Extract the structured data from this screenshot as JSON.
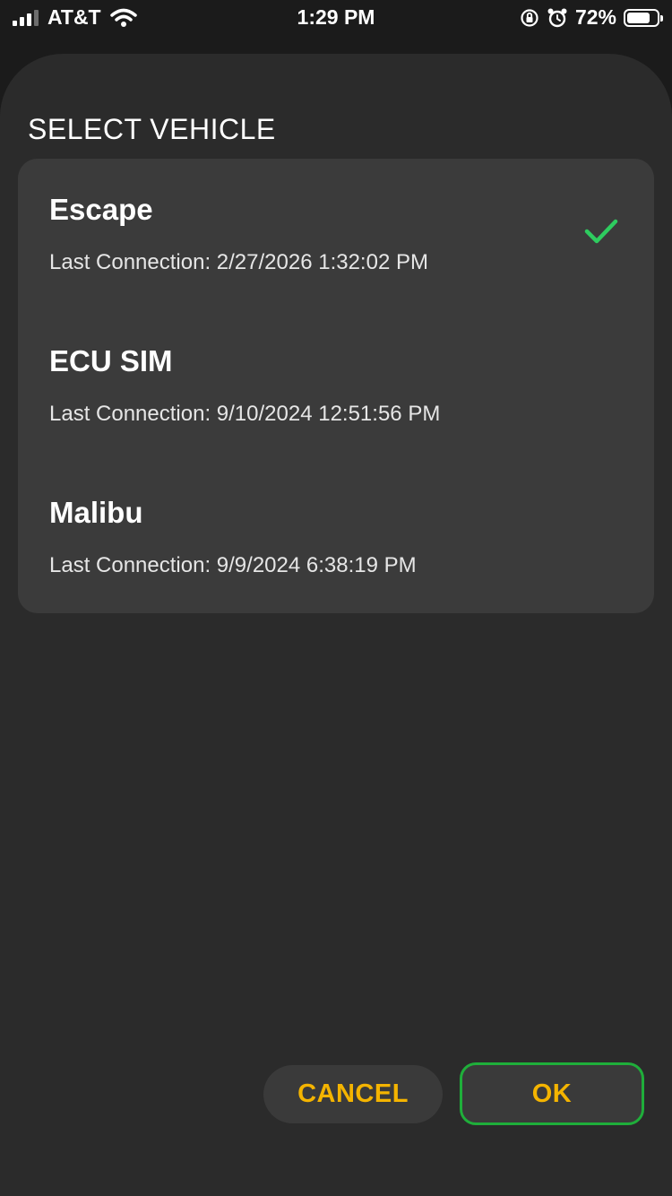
{
  "status_bar": {
    "carrier": "AT&T",
    "time": "1:29 PM",
    "battery_percent": "72%",
    "battery_level": 0.72,
    "icons": [
      "signal-icon",
      "wifi-icon",
      "rotation-lock-icon",
      "alarm-icon",
      "battery-icon"
    ]
  },
  "sheet": {
    "title": "SELECT VEHICLE"
  },
  "vehicles": [
    {
      "name": "Escape",
      "last_connection": "Last Connection: 2/27/2026 1:32:02 PM",
      "selected": true
    },
    {
      "name": "ECU SIM",
      "last_connection": "Last Connection: 9/10/2024 12:51:56 PM",
      "selected": false
    },
    {
      "name": "Malibu",
      "last_connection": "Last Connection: 9/9/2024 6:38:19 PM",
      "selected": false
    }
  ],
  "buttons": {
    "cancel_label": "CANCEL",
    "ok_label": "OK"
  },
  "colors": {
    "accent": "#f4b400",
    "check": "#2ecc5f",
    "highlight_border": "#1fae3a"
  }
}
